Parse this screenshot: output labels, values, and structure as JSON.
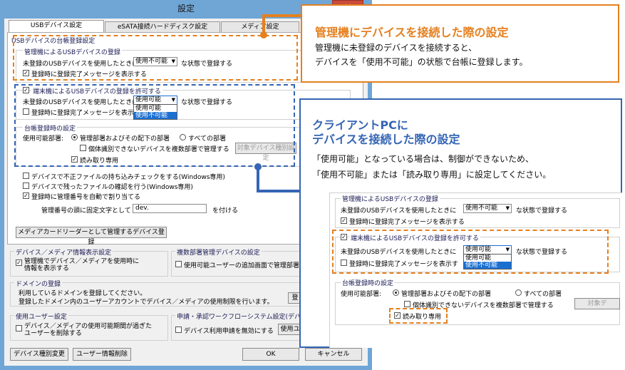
{
  "dialog": {
    "title": "設定",
    "close_glyph": "✕",
    "tabs": [
      {
        "label": "USBデバイス設定",
        "active": true
      },
      {
        "label": "eSATA接続ハードディスク設定",
        "active": false
      },
      {
        "label": "メディア設定",
        "active": false
      }
    ],
    "usb": {
      "section_title": "USBデバイスの台帳登録設定",
      "admin": {
        "group_title": "管理機によるUSBデバイスの登録",
        "line_prefix": "未登録のUSBデバイスを使用したときに",
        "select_value": "使用不可能",
        "line_suffix": "な状態で登録する",
        "msg_checkbox": "登録時に登録完了メッセージを表示する",
        "msg_checked": true
      },
      "terminal": {
        "allow_checkbox": "端末機によるUSBデバイスの登録を許可する",
        "allow_checked": true,
        "line_prefix": "未登録のUSBデバイスを使用したときに",
        "select_value": "使用可能",
        "line_suffix": "な状態で登録する",
        "dropdown_options": [
          "使用可能",
          "使用不可能"
        ],
        "msg_checkbox": "登録時に登録完了メッセージを表示す",
        "msg_checked": false
      },
      "register": {
        "group_title": "台帳登録時の設定",
        "dept_label": "使用可能部署:",
        "radio1": "管理部署およびその配下の部署",
        "radio2": "すべての部署",
        "individual_checkbox": "個体識別できないデバイスを複数部署で管理する",
        "target_button": "対象デバイス種別設定",
        "readonly_checkbox": "読み取り専用",
        "readonly_checked": true
      },
      "misc": {
        "check1": "デバイスで不正ファイルの持ち込みチェックをする(Windows専用)",
        "check2": "デバイスで残ったファイルの確認を行う(Windows専用)",
        "check3": "登録時に管理番号を自動で割り当てる",
        "check3_checked": true,
        "prefix_label": "管理番号の頭に固定文字として",
        "prefix_value": "dev.",
        "prefix_suffix": "を付ける"
      },
      "card_reader_button": "メディアカードリーダーとして管理するデバイス登録"
    },
    "device_info": {
      "group_title": "デバイス／メディア情報表示設定",
      "checkbox_line1": "管理機でデバイス／メディアを使用時に",
      "checkbox_line2": "情報を表示する",
      "checked": true
    },
    "multi_dept": {
      "group_title": "複数部署管理デバイスの設定",
      "checkbox": "使用可能ユーザーの追加画面で管理部署"
    },
    "domain": {
      "group_title": "ドメインの登録",
      "line1": "利用しているドメインを登録してください。",
      "line2": "登録したドメイン内のユーザーアカウントでデバイス／メディアの使用制限を行います。",
      "button": "登"
    },
    "user": {
      "group_title": "使用ユーザー設定",
      "checkbox_line1": "デバイス／メディアの使用可能期間が過ぎた",
      "checkbox_line2": "ユーザーを削除する"
    },
    "workflow": {
      "group_title": "申請・承認ワークフローシステム設定(デバイス",
      "checkbox": "デバイス利用申請を無効にする",
      "button": "使用ユ"
    },
    "footer": {
      "type_change": "デバイス種別変更",
      "user_delete": "ユーザー情報削除",
      "ok": "OK",
      "cancel": "キャンセル"
    }
  },
  "callout_admin": {
    "title": "管理機にデバイスを接続した際の設定",
    "line1": "管理機に未登録のデバイスを接続すると、",
    "line2": "デバイスを「使用不可能」の状態で台帳に登録します。"
  },
  "callout_client": {
    "title_line1": "クライアントPCに",
    "title_line2": "デバイスを接続した際の設定",
    "line1": "「使用可能」となっている場合は、制御ができないため、",
    "line2": "「使用不可能」または「読み取り専用」に設定してください。",
    "zoom": {
      "group_title": "管理機によるUSBデバイスの登録",
      "line_prefix": "未登録のUSBデバイスを使用したときに",
      "select_value": "使用不可能",
      "line_suffix": "な状態で登録する",
      "msg_checkbox": "登録時に登録完了メッセージを表示する",
      "allow_checkbox": "端末機によるUSBデバイスの登録を許可する",
      "t_line_prefix": "未登録のUSBデバイスを使用したときに",
      "t_select_value": "使用可能",
      "t_line_suffix": "な状態で登録する",
      "dropdown_options": [
        "使用可能",
        "使用不可能"
      ],
      "t_msg_checkbox": "登録時に登録完了メッセージを表示す",
      "register_title": "台帳登録時の設定",
      "dept_label": "使用可能部署:",
      "radio1": "管理部署およびその配下の部署",
      "radio2": "すべての部署",
      "individual_checkbox": "個体識別できないデバイスを複数部署で管理する",
      "target_button": "対象デ",
      "readonly_checkbox": "読み取り専用"
    }
  },
  "colors": {
    "orange": "#e5801f",
    "blue": "#3565b5",
    "dialog_frame": "#6fa6d6",
    "close": "#c94a3b"
  }
}
